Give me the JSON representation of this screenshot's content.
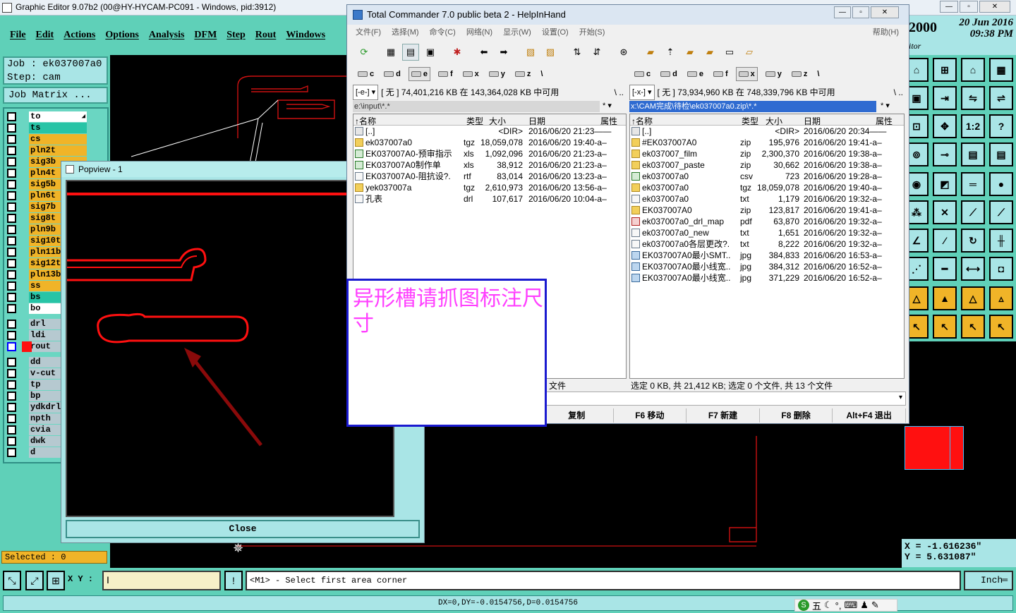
{
  "graphic_editor": {
    "title": "Graphic Editor 9.07b2 (00@HY-HYCAM-PC091 - Windows, pid:3912)",
    "menu": [
      "File",
      "Edit",
      "Actions",
      "Options",
      "Analysis",
      "DFM",
      "Step",
      "Rout",
      "Windows"
    ],
    "job_label": "Job  : ek037007a0",
    "step_label": "Step: cam",
    "job_matrix_button": "Job Matrix ...",
    "layers_group1": [
      {
        "name": "to",
        "color": "white"
      },
      {
        "name": "ts",
        "color": "teal"
      },
      {
        "name": "cs",
        "color": "orange"
      },
      {
        "name": "pln2t",
        "color": "orange"
      },
      {
        "name": "sig3b",
        "color": "orange"
      },
      {
        "name": "pln4t",
        "color": "orange"
      },
      {
        "name": "sig5b",
        "color": "orange"
      },
      {
        "name": "pln6t",
        "color": "orange"
      },
      {
        "name": "sig7b",
        "color": "orange"
      },
      {
        "name": "sig8t",
        "color": "orange"
      },
      {
        "name": "pln9b",
        "color": "orange"
      },
      {
        "name": "sig10t",
        "color": "orange"
      },
      {
        "name": "pln11b",
        "color": "orange"
      },
      {
        "name": "sig12t",
        "color": "orange"
      },
      {
        "name": "pln13b",
        "color": "orange"
      },
      {
        "name": "ss",
        "color": "orange"
      },
      {
        "name": "bs",
        "color": "teal"
      },
      {
        "name": "bo",
        "color": "white"
      }
    ],
    "layers_group2": [
      {
        "name": "drl",
        "color": "gray"
      },
      {
        "name": "ldi",
        "color": "gray"
      },
      {
        "name": "rout",
        "color": "gray",
        "active": true
      }
    ],
    "layers_group3": [
      {
        "name": "dd",
        "color": "gray"
      },
      {
        "name": "v-cut",
        "color": "gray"
      },
      {
        "name": "tp",
        "color": "gray"
      },
      {
        "name": "bp",
        "color": "gray"
      },
      {
        "name": "ydkdrl",
        "color": "gray"
      },
      {
        "name": "npth",
        "color": "gray"
      },
      {
        "name": "cvia",
        "color": "gray"
      },
      {
        "name": "dwk",
        "color": "gray"
      },
      {
        "name": "d",
        "color": "gray"
      }
    ],
    "selected_label": "Selected : 0",
    "xy_label": "X Y :",
    "status_message": "<M1> - Select first area corner",
    "unit_button": "Inch",
    "delta_readout": "DX=0,DY=-0.0154756,D=0.0154756",
    "date_line1": "20 Jun 2016",
    "date_line2": "09:38 PM",
    "version_fragment": "2000",
    "sub_fragment": "itor",
    "coord_x": "X = -1.616236\"",
    "coord_y": "Y =  5.631087\"",
    "tool_labels": {
      "one_to_two": "1:2",
      "help": "?"
    }
  },
  "popview": {
    "title": "Popview - 1",
    "close_label": "Close"
  },
  "total_commander": {
    "title": "Total Commander 7.0 public beta 2 - HelpInHand",
    "menu": [
      "文件(F)",
      "选择(M)",
      "命令(C)",
      "网络(N)",
      "显示(W)",
      "设置(O)",
      "开始(S)"
    ],
    "help_menu": "帮助(H)",
    "drives_left": [
      "c",
      "d",
      "e",
      "f",
      "x",
      "y",
      "z",
      "\\"
    ],
    "drives_right": [
      "c",
      "d",
      "e",
      "f",
      "x",
      "y",
      "z",
      "\\"
    ],
    "left": {
      "drive_select": "[-e-]",
      "free_text": "[ 无 ]  74,401,216 KB 在 143,364,028 KB 中可用",
      "path": "e:\\input\\*.*",
      "status": "文件",
      "files": [
        {
          "name": "[..]",
          "ext": "",
          "size": "<DIR>",
          "date": "2016/06/20 21:23——",
          "icon": "up"
        },
        {
          "name": "ek037007a0",
          "ext": "tgz",
          "size": "18,059,078",
          "date": "2016/06/20 19:40-a–",
          "icon": "folder"
        },
        {
          "name": "EK037007A0-预审指示",
          "ext": "xls",
          "size": "1,092,096",
          "date": "2016/06/20 21:23-a–",
          "icon": "xls"
        },
        {
          "name": "EK037007A0制作单",
          "ext": "xls",
          "size": "38,912",
          "date": "2016/06/20 21:23-a–",
          "icon": "xls"
        },
        {
          "name": "EK037007A0-阻抗设?.",
          "ext": "rtf",
          "size": "83,014",
          "date": "2016/06/20 13:23-a–",
          "icon": "doc"
        },
        {
          "name": "yek037007a",
          "ext": "tgz",
          "size": "2,610,973",
          "date": "2016/06/20 13:56-a–",
          "icon": "folder"
        },
        {
          "name": "孔表",
          "ext": "drl",
          "size": "107,617",
          "date": "2016/06/20 10:04-a–",
          "icon": "doc"
        }
      ]
    },
    "right": {
      "drive_select": "[-x-]",
      "free_text": "[ 无 ]  73,934,960 KB 在 748,339,796 KB 中可用",
      "path": "x:\\CAM完成\\待检\\ek037007a0.zip\\*.*",
      "status": "选定 0 KB, 共 21,412 KB; 选定 0 个文件, 共 13 个文件",
      "files": [
        {
          "name": "[..]",
          "ext": "",
          "size": "<DIR>",
          "date": "2016/06/20 20:34——",
          "icon": "up"
        },
        {
          "name": "#EK037007A0",
          "ext": "zip",
          "size": "195,976",
          "date": "2016/06/20 19:41-a–",
          "icon": "folder"
        },
        {
          "name": "ek037007_film",
          "ext": "zip",
          "size": "2,300,370",
          "date": "2016/06/20 19:38-a–",
          "icon": "folder"
        },
        {
          "name": "ek037007_paste",
          "ext": "zip",
          "size": "30,662",
          "date": "2016/06/20 19:38-a–",
          "icon": "folder"
        },
        {
          "name": "ek037007a0",
          "ext": "csv",
          "size": "723",
          "date": "2016/06/20 19:28-a–",
          "icon": "xls"
        },
        {
          "name": "ek037007a0",
          "ext": "tgz",
          "size": "18,059,078",
          "date": "2016/06/20 19:40-a–",
          "icon": "folder"
        },
        {
          "name": "ek037007a0",
          "ext": "txt",
          "size": "1,179",
          "date": "2016/06/20 19:32-a–",
          "icon": "doc"
        },
        {
          "name": "EK037007A0",
          "ext": "zip",
          "size": "123,817",
          "date": "2016/06/20 19:41-a–",
          "icon": "folder"
        },
        {
          "name": "ek037007a0_drl_map",
          "ext": "pdf",
          "size": "63,870",
          "date": "2016/06/20 19:32-a–",
          "icon": "pdf"
        },
        {
          "name": "ek037007a0_new",
          "ext": "txt",
          "size": "1,651",
          "date": "2016/06/20 19:32-a–",
          "icon": "doc"
        },
        {
          "name": "ek037007a0各层更改?.",
          "ext": "txt",
          "size": "8,222",
          "date": "2016/06/20 19:32-a–",
          "icon": "doc"
        },
        {
          "name": "EK037007A0最小SMT..",
          "ext": "jpg",
          "size": "384,833",
          "date": "2016/06/20 16:53-a–",
          "icon": "img"
        },
        {
          "name": "EK037007A0最小线宽..",
          "ext": "jpg",
          "size": "384,312",
          "date": "2016/06/20 16:52-a–",
          "icon": "img"
        },
        {
          "name": "EK037007A0最小线宽..",
          "ext": "jpg",
          "size": "371,229",
          "date": "2016/06/20 16:52-a–",
          "icon": "img"
        }
      ]
    },
    "columns": {
      "name": "↑名称",
      "type": "类型",
      "size": "大小",
      "date": "日期",
      "attr": "属性"
    },
    "fkeys": [
      "复制",
      "F6 移动",
      "F7 新建",
      "F8 删除",
      "Alt+F4 退出"
    ]
  },
  "note": {
    "text": "异形槽请抓图标注尺寸"
  },
  "ime": {
    "label": "五"
  }
}
